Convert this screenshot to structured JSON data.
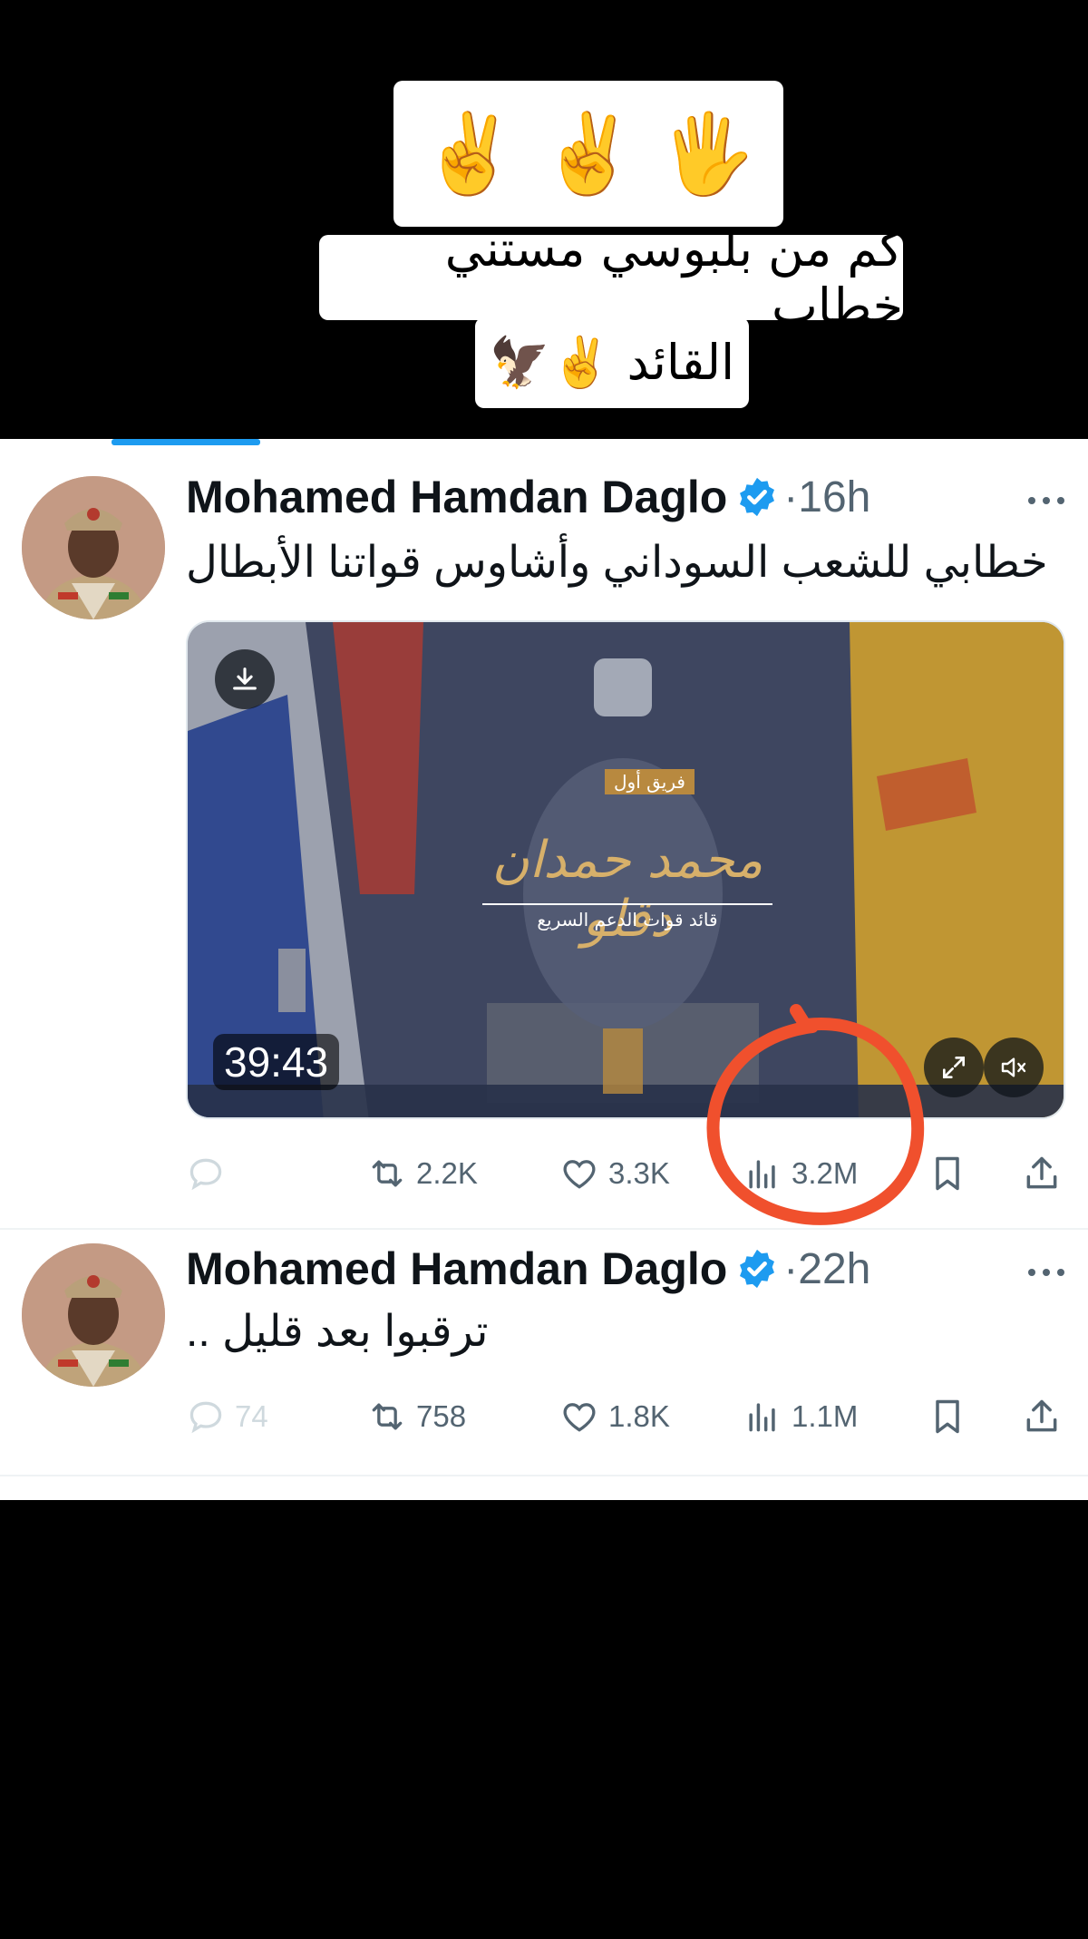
{
  "overlay": {
    "emojis": [
      "✌️",
      "✌️",
      "🖐️"
    ],
    "caption_line1": "كم من بلبوسي مستني خطاب",
    "caption_line2": "القائد ✌️🦅"
  },
  "colors": {
    "accent": "#1d9bf0",
    "annotation": "#f0502d",
    "text_secondary": "#536471"
  },
  "tweets": [
    {
      "author": "Mohamed Hamdan Daglo",
      "verified": true,
      "separator": "·",
      "time": "16h",
      "text": "خطابي للشعب السوداني وأشاوس قواتنا الأبطال",
      "media": {
        "duration": "39:43",
        "title_rank": "فريق أول",
        "title_name": "محمد حمدان دقلو",
        "title_subtitle": "قائد قوات الدعم السريع"
      },
      "stats": {
        "replies": "",
        "retweets": "2.2K",
        "likes": "3.3K",
        "views": "3.2M"
      }
    },
    {
      "author": "Mohamed Hamdan Daglo",
      "verified": true,
      "separator": "·",
      "time": "22h",
      "text": "ترقبوا بعد قليل ..",
      "stats": {
        "replies": "74",
        "retweets": "758",
        "likes": "1.8K",
        "views": "1.1M"
      }
    }
  ],
  "icons": [
    "download-icon",
    "expand-icon",
    "mute-icon",
    "reply-icon",
    "retweet-icon",
    "like-icon",
    "views-icon",
    "bookmark-icon",
    "share-icon",
    "more-icon",
    "verified-icon"
  ]
}
